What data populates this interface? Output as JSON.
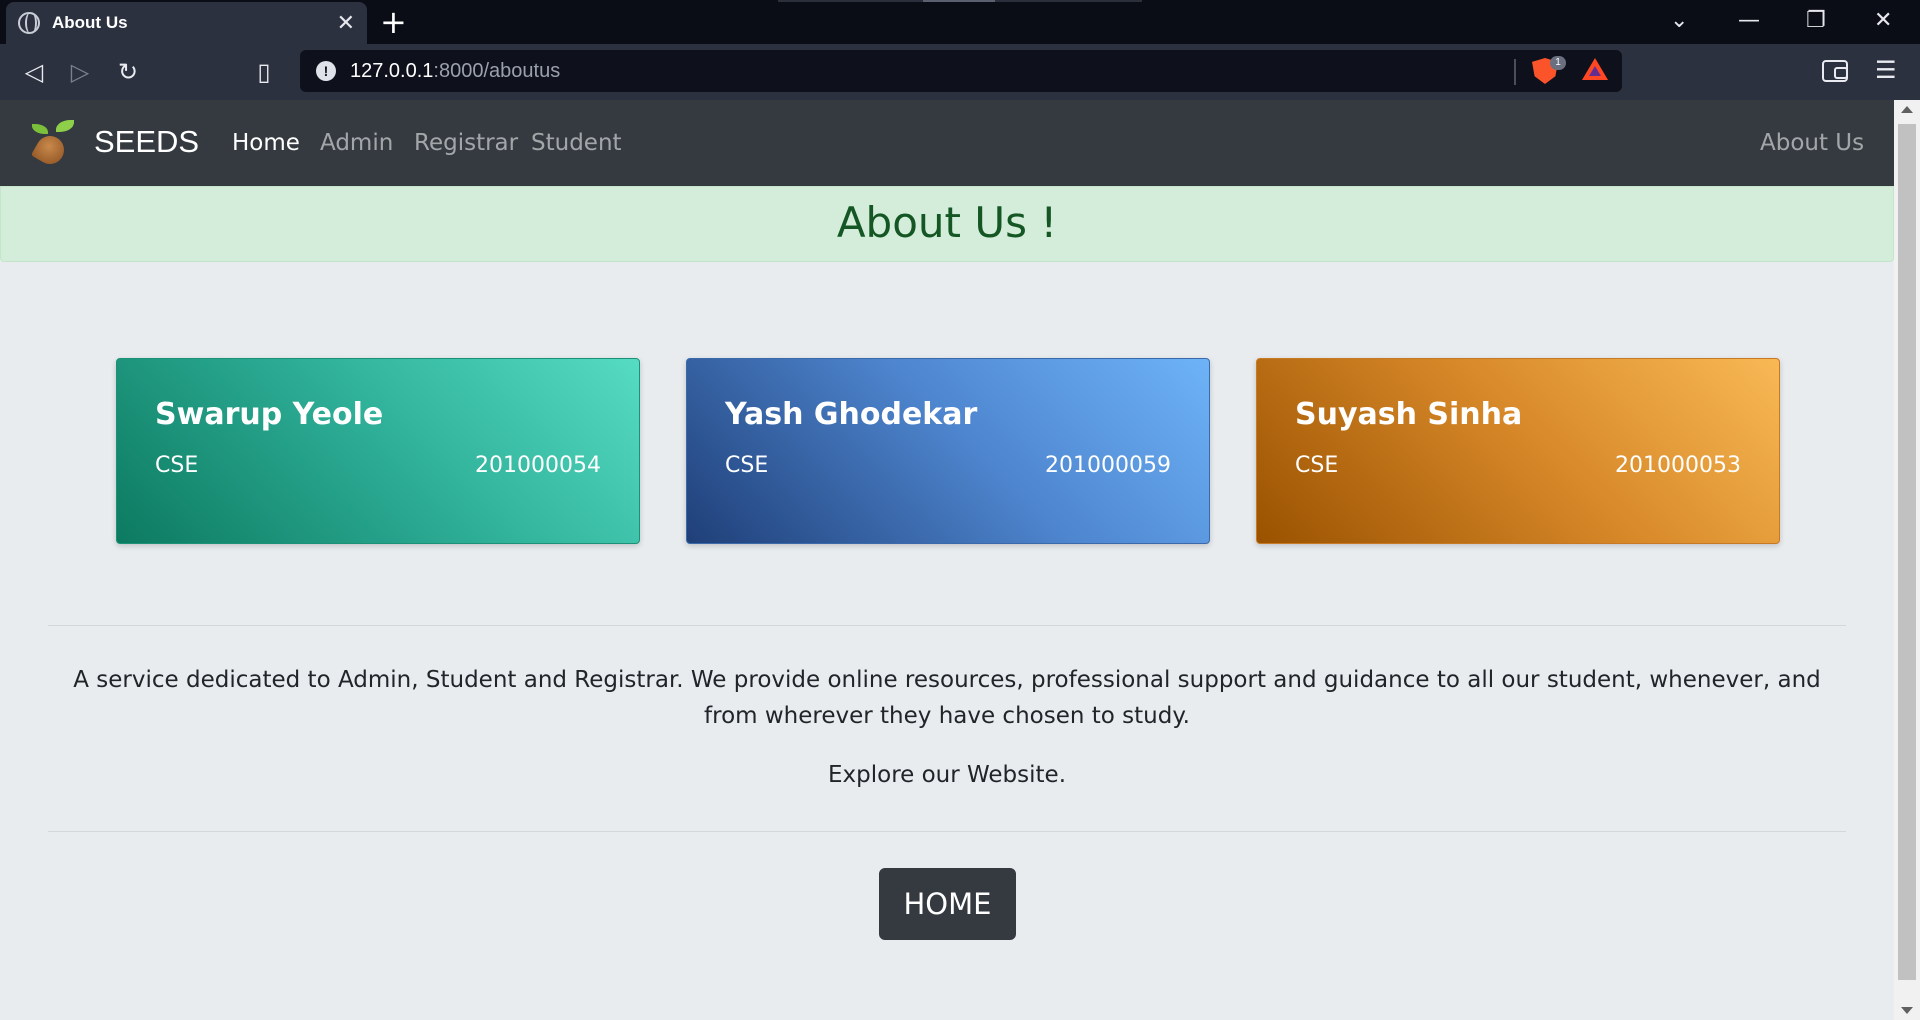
{
  "browser": {
    "tab_title": "About Us",
    "tab_close": "✕",
    "new_tab": "+",
    "url_host": "127.0.0.1",
    "url_path": ":8000/aboutus",
    "brave_badge": "1",
    "window_controls": [
      "⌄",
      "—",
      "❐",
      "✕"
    ]
  },
  "navbar": {
    "brand": "SEEDS",
    "links": [
      "Home",
      "Admin",
      "Registrar",
      "Student"
    ],
    "right_link": "About Us"
  },
  "alert": {
    "heading": "About Us !"
  },
  "members": [
    {
      "name": "Swarup Yeole",
      "dept": "CSE",
      "roll": "201000054"
    },
    {
      "name": "Yash Ghodekar",
      "dept": "CSE",
      "roll": "201000059"
    },
    {
      "name": "Suyash Sinha",
      "dept": "CSE",
      "roll": "201000053"
    }
  ],
  "about": {
    "description": "A service dedicated to Admin, Student and Registrar. We provide online resources, professional support and guidance to all our student, whenever, and from wherever they have chosen to study.",
    "explore": "Explore our Website.",
    "home_button": "HOME"
  }
}
